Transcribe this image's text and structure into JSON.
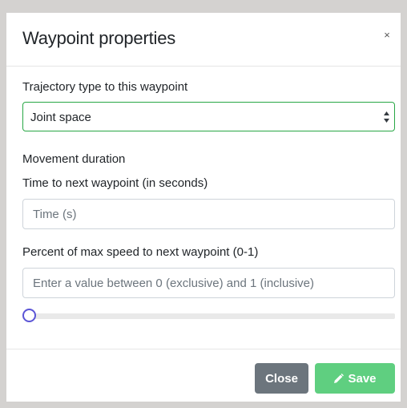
{
  "modal": {
    "title": "Waypoint properties",
    "close_glyph": "×"
  },
  "trajectory": {
    "label": "Trajectory type to this waypoint",
    "selected": "Joint space"
  },
  "duration": {
    "section_label": "Movement duration",
    "time_label": "Time to next waypoint (in seconds)",
    "time_placeholder": "Time (s)",
    "time_value": ""
  },
  "speed": {
    "label": "Percent of max speed to next waypoint (0-1)",
    "placeholder": "Enter a value between 0 (exclusive) and 1 (inclusive)",
    "value": "",
    "slider_value": 0
  },
  "footer": {
    "close_label": "Close",
    "save_label": "Save"
  },
  "colors": {
    "select_border": "#28a745",
    "slider_thumb": "#5b55d6",
    "close_button": "#6c757d",
    "save_button": "#5fcf80"
  },
  "icons": {
    "select": "chevron-updown-icon",
    "save": "pencil-icon",
    "close": "close-icon"
  }
}
